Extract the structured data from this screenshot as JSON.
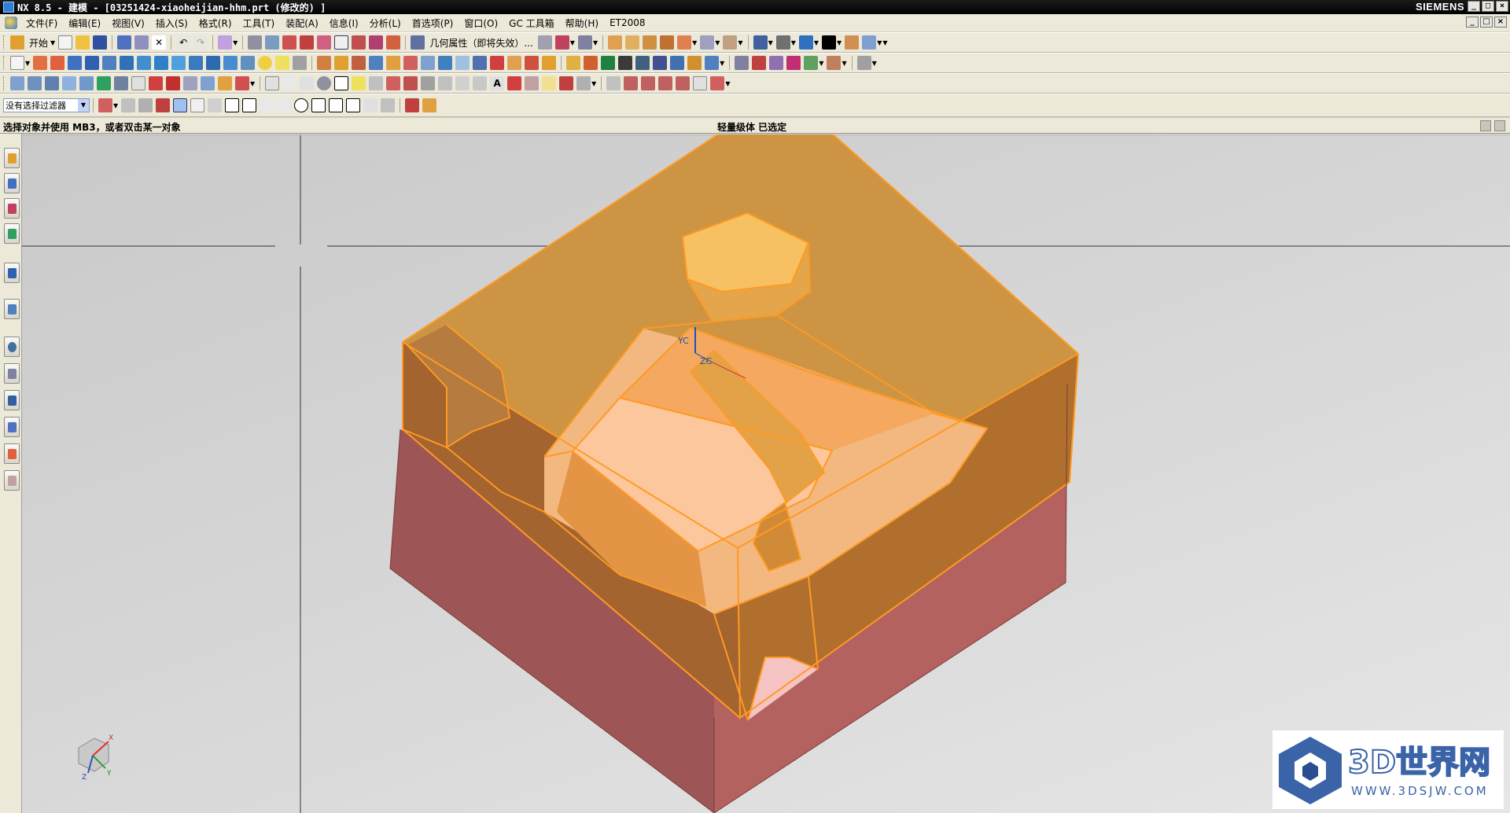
{
  "window": {
    "title": "NX 8.5 - 建模 - [03251424-xiaoheijian-hhm.prt (修改的) ]",
    "brand": "SIEMENS",
    "buttons": [
      "_",
      "□",
      "×"
    ]
  },
  "menubar": {
    "items": [
      "文件(F)",
      "编辑(E)",
      "视图(V)",
      "插入(S)",
      "格式(R)",
      "工具(T)",
      "装配(A)",
      "信息(I)",
      "分析(L)",
      "首选项(P)",
      "窗口(O)",
      "GC 工具箱",
      "帮助(H)",
      "ET2008"
    ]
  },
  "toolbar1": {
    "start_label": "开始",
    "info_label": "几何属性（即将失效）..."
  },
  "selection_bar": {
    "filter_value": "没有选择过滤器"
  },
  "statusbar": {
    "prompt": "选择对象并使用 MB3，或者双击某一对象",
    "status": "轻量级体 已选定"
  },
  "viewport": {
    "csys_labels": {
      "yc": "YC",
      "zc": "ZC"
    },
    "triad_labels": {
      "x": "X",
      "y": "Y",
      "z": "Z"
    },
    "colors": {
      "background": "#d0d0d0",
      "selected_body": "#f5a623",
      "selected_edge": "#ff9a22",
      "base_body": "#b06060"
    }
  },
  "watermark": {
    "text": "3D世界网",
    "url": "WWW.3DSJW.COM"
  }
}
